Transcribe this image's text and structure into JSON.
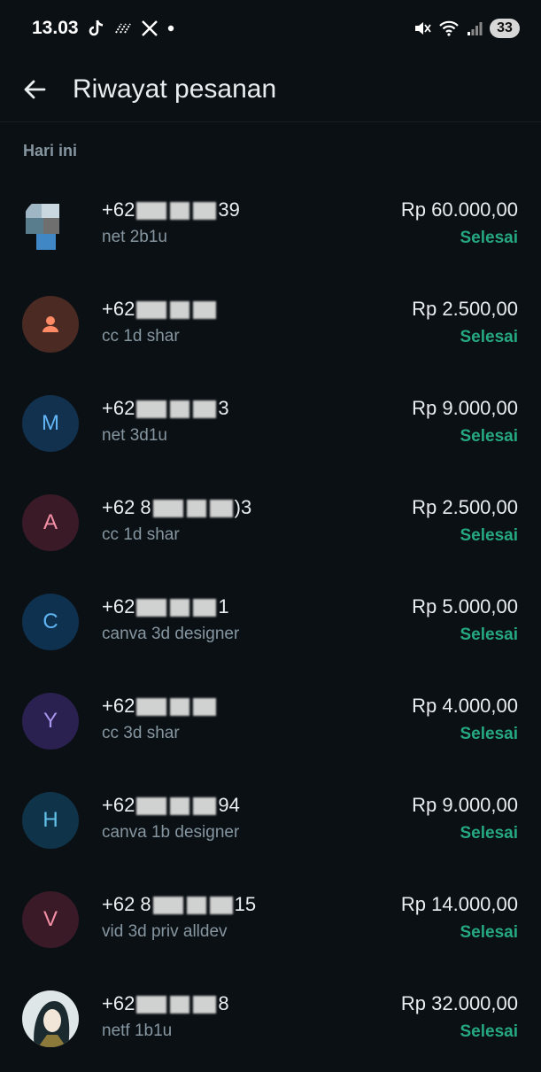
{
  "status_bar": {
    "time": "13.03",
    "battery": "33",
    "icons": [
      "tiktok-icon",
      "signal-dots-icon",
      "x-icon",
      "dot-icon",
      "mute-icon",
      "wifi-icon",
      "cell-signal-icon"
    ]
  },
  "app_bar": {
    "title": "Riwayat pesanan",
    "back_icon": "arrow-left-icon"
  },
  "section": {
    "title": "Hari ini"
  },
  "colors": {
    "background": "#0b1014",
    "status_done": "#25a882",
    "secondary_text": "#8696a0"
  },
  "orders": [
    {
      "phone_prefix": "+62",
      "phone_suffix": "39",
      "product": "net 2b1u",
      "amount": "Rp 60.000,00",
      "status": "Selesai",
      "avatar_type": "image",
      "avatar_letter": ""
    },
    {
      "phone_prefix": "+62",
      "phone_suffix": "",
      "product": "cc 1d shar",
      "amount": "Rp 2.500,00",
      "status": "Selesai",
      "avatar_type": "person",
      "avatar_letter": ""
    },
    {
      "phone_prefix": "+62",
      "phone_suffix": "3",
      "product": "net 3d1u",
      "amount": "Rp 9.000,00",
      "status": "Selesai",
      "avatar_type": "letter",
      "avatar_letter": "M",
      "avatar_bg": "#11314f",
      "avatar_fg": "#64b5f6"
    },
    {
      "phone_prefix": "+62 8",
      "phone_suffix": ")3",
      "product": "cc 1d shar",
      "amount": "Rp 2.500,00",
      "status": "Selesai",
      "avatar_type": "letter",
      "avatar_letter": "A",
      "avatar_bg": "#3a1a26",
      "avatar_fg": "#f48fa6"
    },
    {
      "phone_prefix": "+62",
      "phone_suffix": "1",
      "product": "canva 3d designer",
      "amount": "Rp 5.000,00",
      "status": "Selesai",
      "avatar_type": "letter",
      "avatar_letter": "C",
      "avatar_bg": "#0e3150",
      "avatar_fg": "#5fb4f2"
    },
    {
      "phone_prefix": "+62",
      "phone_suffix": "",
      "product": "cc 3d shar",
      "amount": "Rp 4.000,00",
      "status": "Selesai",
      "avatar_type": "letter",
      "avatar_letter": "Y",
      "avatar_bg": "#2a2150",
      "avatar_fg": "#a997ef"
    },
    {
      "phone_prefix": "+62",
      "phone_suffix": "94",
      "product": "canva 1b designer",
      "amount": "Rp 9.000,00",
      "status": "Selesai",
      "avatar_type": "letter",
      "avatar_letter": "H",
      "avatar_bg": "#0f3349",
      "avatar_fg": "#63c1ea"
    },
    {
      "phone_prefix": "+62 8",
      "phone_suffix": "15",
      "product": "vid 3d priv alldev",
      "amount": "Rp 14.000,00",
      "status": "Selesai",
      "avatar_type": "letter",
      "avatar_letter": "V",
      "avatar_bg": "#3a1a26",
      "avatar_fg": "#f48fa6"
    },
    {
      "phone_prefix": "+62",
      "phone_suffix": "8",
      "product": "netf 1b1u",
      "amount": "Rp 32.000,00",
      "status": "Selesai",
      "avatar_type": "image",
      "avatar_letter": ""
    }
  ]
}
